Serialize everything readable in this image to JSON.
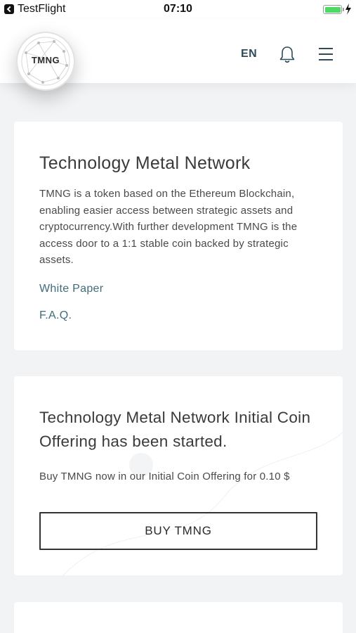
{
  "status_bar": {
    "app_name": "TestFlight",
    "time": "07:10"
  },
  "header": {
    "logo_text": "TMNG",
    "language": "EN"
  },
  "intro_card": {
    "title": "Technology Metal Network",
    "description": "TMNG is a token based on the Ethereum Blockchain, enabling easier access between strategic assets and cryptocurrency.With further development TMNG is the access door to a 1:1 stable coin backed by strategic assets.",
    "links": [
      "White Paper",
      "F.A.Q."
    ]
  },
  "ico_card": {
    "title": "Technology Metal Network Initial Coin Offering has been started.",
    "text": "Buy TMNG now in our Initial Coin Offering for 0.10 $",
    "button_label": "BUY TMNG"
  },
  "colors": {
    "background": "#f2f3f5",
    "accent_link": "#3f6b7a",
    "battery": "#4cd964"
  }
}
